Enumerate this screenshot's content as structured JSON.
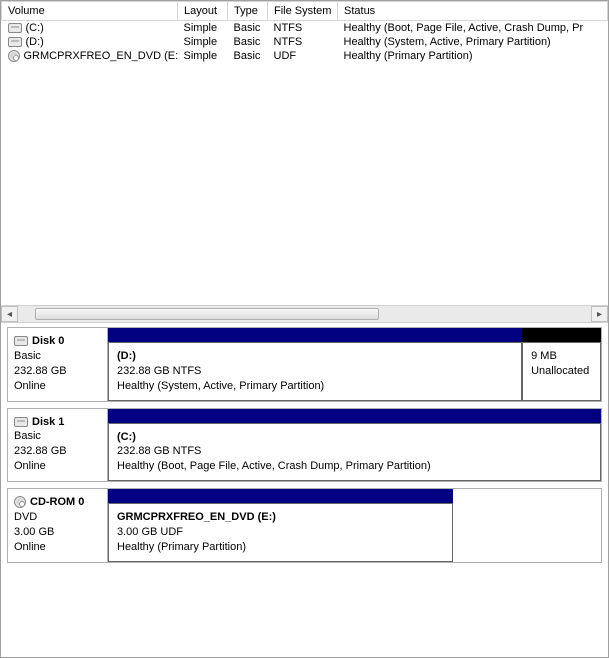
{
  "columns": {
    "volume": "Volume",
    "layout": "Layout",
    "type": "Type",
    "filesystem": "File System",
    "status": "Status"
  },
  "volumes": [
    {
      "icon": "drive",
      "name": "(C:)",
      "layout": "Simple",
      "type": "Basic",
      "fs": "NTFS",
      "status": "Healthy (Boot, Page File, Active, Crash Dump, Pr"
    },
    {
      "icon": "drive",
      "name": "(D:)",
      "layout": "Simple",
      "type": "Basic",
      "fs": "NTFS",
      "status": "Healthy (System, Active, Primary Partition)"
    },
    {
      "icon": "disc",
      "name": "GRMCPRXFREO_EN_DVD (E:)",
      "layout": "Simple",
      "type": "Basic",
      "fs": "UDF",
      "status": "Healthy (Primary Partition)"
    }
  ],
  "disks": [
    {
      "icon": "drive",
      "name": "Disk 0",
      "type": "Basic",
      "size": "232.88 GB",
      "state": "Online",
      "segments": [
        {
          "color": "navy",
          "width": "84%",
          "label": "(D:)",
          "line2": "232.88 GB NTFS",
          "line3": "Healthy (System, Active, Primary Partition)"
        },
        {
          "color": "black",
          "width": "16%",
          "label": "",
          "line2": "9 MB",
          "line3": "Unallocated"
        }
      ]
    },
    {
      "icon": "drive",
      "name": "Disk 1",
      "type": "Basic",
      "size": "232.88 GB",
      "state": "Online",
      "segments": [
        {
          "color": "navy",
          "width": "100%",
          "label": "(C:)",
          "line2": "232.88 GB NTFS",
          "line3": "Healthy (Boot, Page File, Active, Crash Dump, Primary Partition)"
        }
      ]
    },
    {
      "icon": "disc",
      "name": "CD-ROM 0",
      "type": "DVD",
      "size": "3.00 GB",
      "state": "Online",
      "segments": [
        {
          "color": "navy",
          "width": "70%",
          "label": "GRMCPRXFREO_EN_DVD  (E:)",
          "line2": "3.00 GB UDF",
          "line3": "Healthy (Primary Partition)"
        }
      ]
    }
  ]
}
